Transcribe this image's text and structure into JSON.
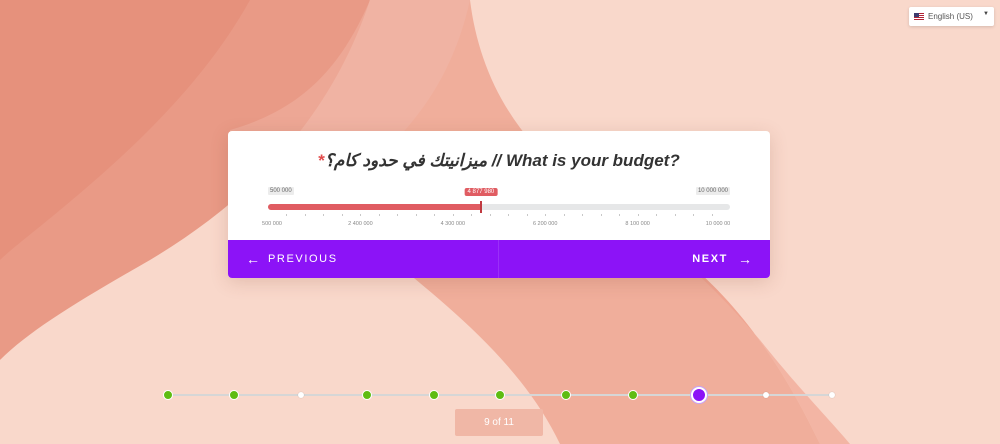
{
  "language": {
    "label": "English (US)",
    "icon": "us-flag-icon",
    "caret": "▼"
  },
  "question": {
    "required_mark": "*",
    "text": "ميزانيتك في حدود كام؟ // What is your budget?"
  },
  "slider": {
    "min_label": "500 000",
    "max_label": "10 000 000",
    "current_label": "4 877 980",
    "min": 500000,
    "max": 10000000,
    "value": 4877980,
    "scale": [
      {
        "label": "500 000",
        "value": 500000
      },
      {
        "label": "2 400 000",
        "value": 2400000
      },
      {
        "label": "4 300 000",
        "value": 4300000
      },
      {
        "label": "6 200 000",
        "value": 6200000
      },
      {
        "label": "8 100 000",
        "value": 8100000
      },
      {
        "label": "10 000 00",
        "value": 10000000
      }
    ],
    "colors": {
      "fill": "#e05c62",
      "track": "#e6e7e8"
    }
  },
  "nav": {
    "prev_label": "PREVIOUS",
    "prev_icon": "arrow-left-icon",
    "next_label": "NEXT",
    "next_icon": "arrow-right-icon",
    "color": "#8c13f7"
  },
  "progress": {
    "steps": [
      "done",
      "done",
      "empty",
      "done",
      "done",
      "done",
      "done",
      "done",
      "current",
      "empty",
      "empty"
    ],
    "counter": "9 of 11",
    "colors": {
      "done": "#5ebc12",
      "current": "#8c13f7"
    }
  }
}
